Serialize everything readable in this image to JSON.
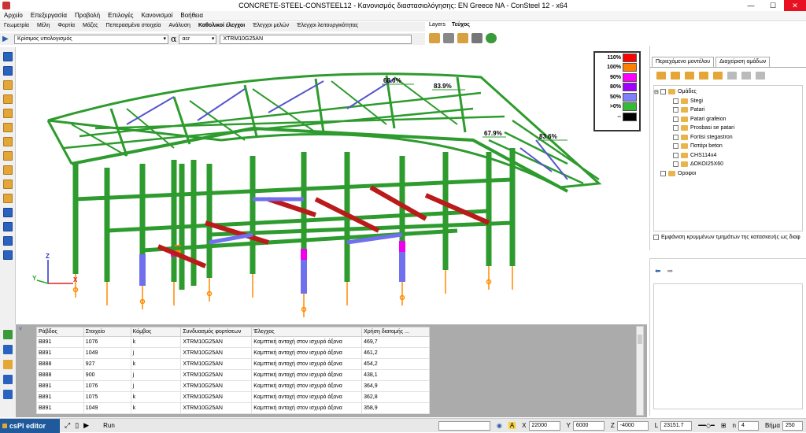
{
  "window": {
    "title": "CONCRETE-STEEL-CONSTEEL12 - Κανονισμός διαστασιολόγησης: EN Greece NA - ConSteel 12 - x64",
    "minimize": "—",
    "maximize": "☐",
    "close": "✕"
  },
  "menu": [
    "Αρχείο",
    "Επεξεργασία",
    "Προβολή",
    "Επιλογές",
    "Κανονισμοί",
    "Βοήθεια"
  ],
  "ribbon_tabs": [
    "Γεωμετρία",
    "Μέλη",
    "Φορτία",
    "Μάζες",
    "Πεπερασμένα στοιχεία",
    "Ανάλυση",
    "Καθολικοί έλεγχοι",
    "Έλεγχοι μελών",
    "Έλεγχοι λειτουργικότητας"
  ],
  "ribbon_active": "Καθολικοί έλεγχοι",
  "layers_tabs": {
    "layers": "Layers",
    "teuxos": "Τεύχος"
  },
  "toolbar": {
    "mode_select": "Κρίσιμος υπολογισμός",
    "alpha_symbol": "α",
    "alpha_select": "αcr",
    "combo_value": "XTRM10G25AN"
  },
  "legend": [
    {
      "label": "110%",
      "color": "#ff0000"
    },
    {
      "label": "100%",
      "color": "#ff8000"
    },
    {
      "label": "90%",
      "color": "#ff00ff"
    },
    {
      "label": "80%",
      "color": "#a000ff"
    },
    {
      "label": "50%",
      "color": "#8080ff"
    },
    {
      "label": ">0%",
      "color": "#33bb33"
    },
    {
      "label": "--",
      "color": "#000000"
    }
  ],
  "utilization_labels": [
    "68.0%",
    "83.9%",
    "67.9%",
    "83.6%"
  ],
  "axes": {
    "z": "Z",
    "y": "Y",
    "x": "X"
  },
  "right_panel": {
    "tab_content": "Περιεχόμενο μοντέλου",
    "tab_groups": "Διαχείριση ομάδων",
    "tree": {
      "root1": "Ομάδες",
      "children": [
        "Stegi",
        "Patari",
        "Patari grafeion",
        "Prosbasi se patari",
        "Fortisi stegastron",
        "Πατάρι beton",
        "CHS114x4",
        "ΔΟΚΟΙ25X60"
      ],
      "root2": "Οροφοι"
    },
    "hidden_label": "Εμφάνιση κρυμμένων τμημάτων της κατασκευής ως διαφ"
  },
  "results_table": {
    "headers": [
      "Ράβδος",
      "Στοιχείο",
      "Κόμβος",
      "Συνδυασμός φορτίσεων",
      "Έλεγχος",
      "Χρήση διατομής ..."
    ],
    "rows": [
      [
        "B891",
        "1076",
        "k",
        "XTRM10G25AN",
        "Καμπτική αντοχή στον ισχυρό άξονα",
        "469,7"
      ],
      [
        "B891",
        "1049",
        "j",
        "XTRM10G25AN",
        "Καμπτική αντοχή στον ισχυρό άξονα",
        "461,2"
      ],
      [
        "B888",
        "927",
        "k",
        "XTRM10G25AN",
        "Καμπτική αντοχή στον ισχυρό άξονα",
        "454,2"
      ],
      [
        "B888",
        "900",
        "j",
        "XTRM10G25AN",
        "Καμπτική αντοχή στον ισχυρό άξονα",
        "438,1"
      ],
      [
        "B891",
        "1076",
        "j",
        "XTRM10G25AN",
        "Καμπτική αντοχή στον ισχυρό άξονα",
        "364,9"
      ],
      [
        "B891",
        "1075",
        "k",
        "XTRM10G25AN",
        "Καμπτική αντοχή στον ισχυρό άξονα",
        "362,8"
      ],
      [
        "B891",
        "1049",
        "k",
        "XTRM10G25AN",
        "Καμπτική αντοχή στον ισχυρό άξονα",
        "358,9"
      ]
    ]
  },
  "status": {
    "cspi": "csPI editor",
    "run": "Run",
    "x_label": "X",
    "x_value": "22000",
    "y_label": "Y",
    "y_value": "6000",
    "z_label": "Z",
    "z_value": "-4000",
    "l_label": "L",
    "l_value": "23151.7",
    "n_label": "n",
    "n_value": "4",
    "step_label": "Βήμα",
    "step_value": "250"
  }
}
